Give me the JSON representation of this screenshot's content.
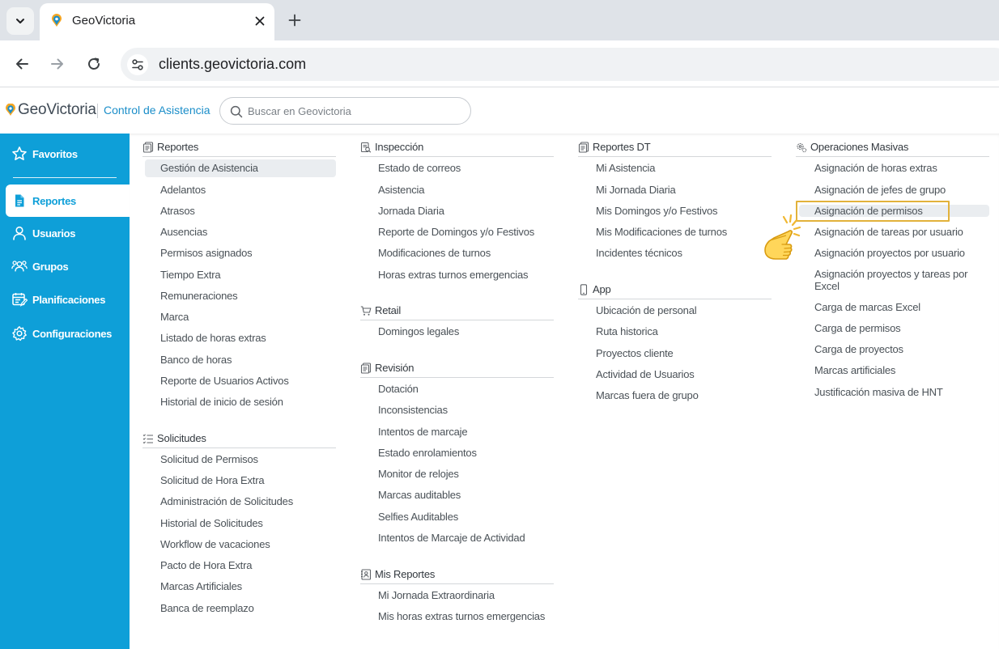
{
  "browser": {
    "tab_title": "GeoVictoria",
    "url": "clients.geovictoria.com"
  },
  "header": {
    "logo_text": "GeoVictoria",
    "app_name": "Control de Asistencia",
    "search_placeholder": "Buscar en Geovictoria"
  },
  "sidebar": {
    "items": [
      {
        "label": "Favoritos",
        "icon": "star-icon"
      },
      {
        "label": "Reportes",
        "icon": "document-icon",
        "active": true
      },
      {
        "label": "Usuarios",
        "icon": "user-icon"
      },
      {
        "label": "Grupos",
        "icon": "group-icon"
      },
      {
        "label": "Planificaciones",
        "icon": "calendar-edit-icon"
      },
      {
        "label": "Configuraciones",
        "icon": "gear-icon"
      }
    ]
  },
  "menu": {
    "col1": {
      "reportes": {
        "title": "Reportes",
        "items": [
          "Gestión de Asistencia",
          "Adelantos",
          "Atrasos",
          "Ausencias",
          "Permisos asignados",
          "Tiempo Extra",
          "Remuneraciones",
          "Marca",
          "Listado de horas extras",
          "Banco de horas",
          "Reporte de Usuarios Activos",
          "Historial de inicio de sesión"
        ]
      },
      "solicitudes": {
        "title": "Solicitudes",
        "items": [
          "Solicitud de Permisos",
          "Solicitud de Hora Extra",
          "Administración de Solicitudes",
          "Historial de Solicitudes",
          "Workflow de vacaciones",
          "Pacto de Hora Extra",
          "Marcas Artificiales",
          "Banca de reemplazo"
        ]
      }
    },
    "col2": {
      "inspeccion": {
        "title": "Inspección",
        "items": [
          "Estado de correos",
          "Asistencia",
          "Jornada Diaria",
          "Reporte de Domingos y/o Festivos",
          "Modificaciones de turnos",
          "Horas extras turnos emergencias"
        ]
      },
      "retail": {
        "title": "Retail",
        "items": [
          "Domingos legales"
        ]
      },
      "revision": {
        "title": "Revisión",
        "items": [
          "Dotación",
          "Inconsistencias",
          "Intentos de marcaje",
          "Estado enrolamientos",
          "Monitor de relojes",
          "Marcas auditables",
          "Selfies Auditables",
          "Intentos de Marcaje de Actividad"
        ]
      },
      "mis_reportes": {
        "title": "Mis Reportes",
        "items": [
          "Mi Jornada Extraordinaria",
          "Mis horas extras turnos emergencias"
        ]
      }
    },
    "col3": {
      "reportes_dt": {
        "title": "Reportes DT",
        "items": [
          "Mi Asistencia",
          "Mi Jornada Diaria",
          "Mis Domingos y/o Festivos",
          "Mis Modificaciones de turnos",
          "Incidentes técnicos"
        ]
      },
      "app": {
        "title": "App",
        "items": [
          "Ubicación de personal",
          "Ruta historica",
          "Proyectos cliente",
          "Actividad de Usuarios",
          "Marcas fuera de grupo"
        ]
      }
    },
    "col4": {
      "operaciones": {
        "title": "Operaciones Masivas",
        "items": [
          "Asignación de horas extras",
          "Asignación de jefes de grupo",
          "Asignación de permisos",
          "Asignación de tareas por usuario",
          "Asignación proyectos por usuario",
          "Asignación proyectos y tareas por",
          "Excel",
          "Carga de marcas Excel",
          "Carga de permisos",
          "Carga de proyectos",
          "Marcas artificiales",
          "Justificación masiva de HNT"
        ]
      }
    }
  },
  "colors": {
    "sidebar_bg": "#0e9fd8",
    "accent_link": "#1b8ec9",
    "highlight_box": "#e2b23b",
    "hover_row": "#eaedf0"
  }
}
